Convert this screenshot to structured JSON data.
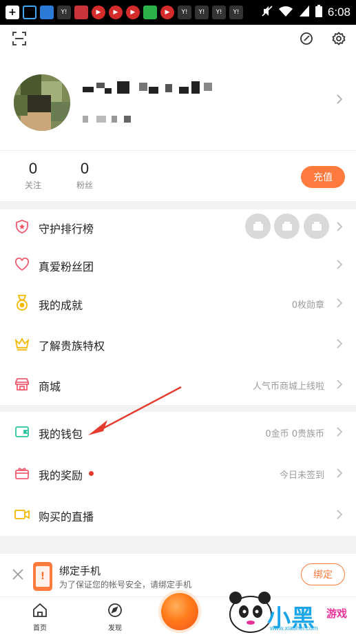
{
  "status_bar": {
    "time": "6:08",
    "icons": [
      "plus-icon",
      "lock-icon",
      "app-icon",
      "yi-icon",
      "app-icon",
      "play-icon",
      "play-icon",
      "play-icon",
      "app-icon",
      "play-icon",
      "yi-icon",
      "yi-icon",
      "yi-icon",
      "yi-icon"
    ]
  },
  "profile": {
    "username_hidden": true
  },
  "stats": {
    "following_count": "0",
    "following_label": "关注",
    "fans_count": "0",
    "fans_label": "粉丝",
    "recharge_label": "充值"
  },
  "menu": {
    "guard_rank": "守护排行榜",
    "fan_club": "真爱粉丝团",
    "achievements": "我的成就",
    "achievements_value": "0枚勋章",
    "noble": "了解贵族特权",
    "mall": "商城",
    "mall_value": "人气币商城上线啦",
    "wallet": "我的钱包",
    "wallet_value": "0金币 0贵族币",
    "rewards": "我的奖励",
    "rewards_value": "今日未签到",
    "purchased": "购买的直播"
  },
  "banner": {
    "title": "绑定手机",
    "subtitle": "为了保证您的帐号安全，请绑定手机",
    "button": "绑定",
    "phone_glyph": "!"
  },
  "tabbar": {
    "home": "首页",
    "discover": "发现"
  },
  "watermark": {
    "text": "小黑",
    "game": "游戏",
    "url": "www.xiaohei.com"
  },
  "colors": {
    "accent": "#ff7a3d",
    "red_dot": "#e53b2e",
    "arrow": "#e53b2e"
  }
}
